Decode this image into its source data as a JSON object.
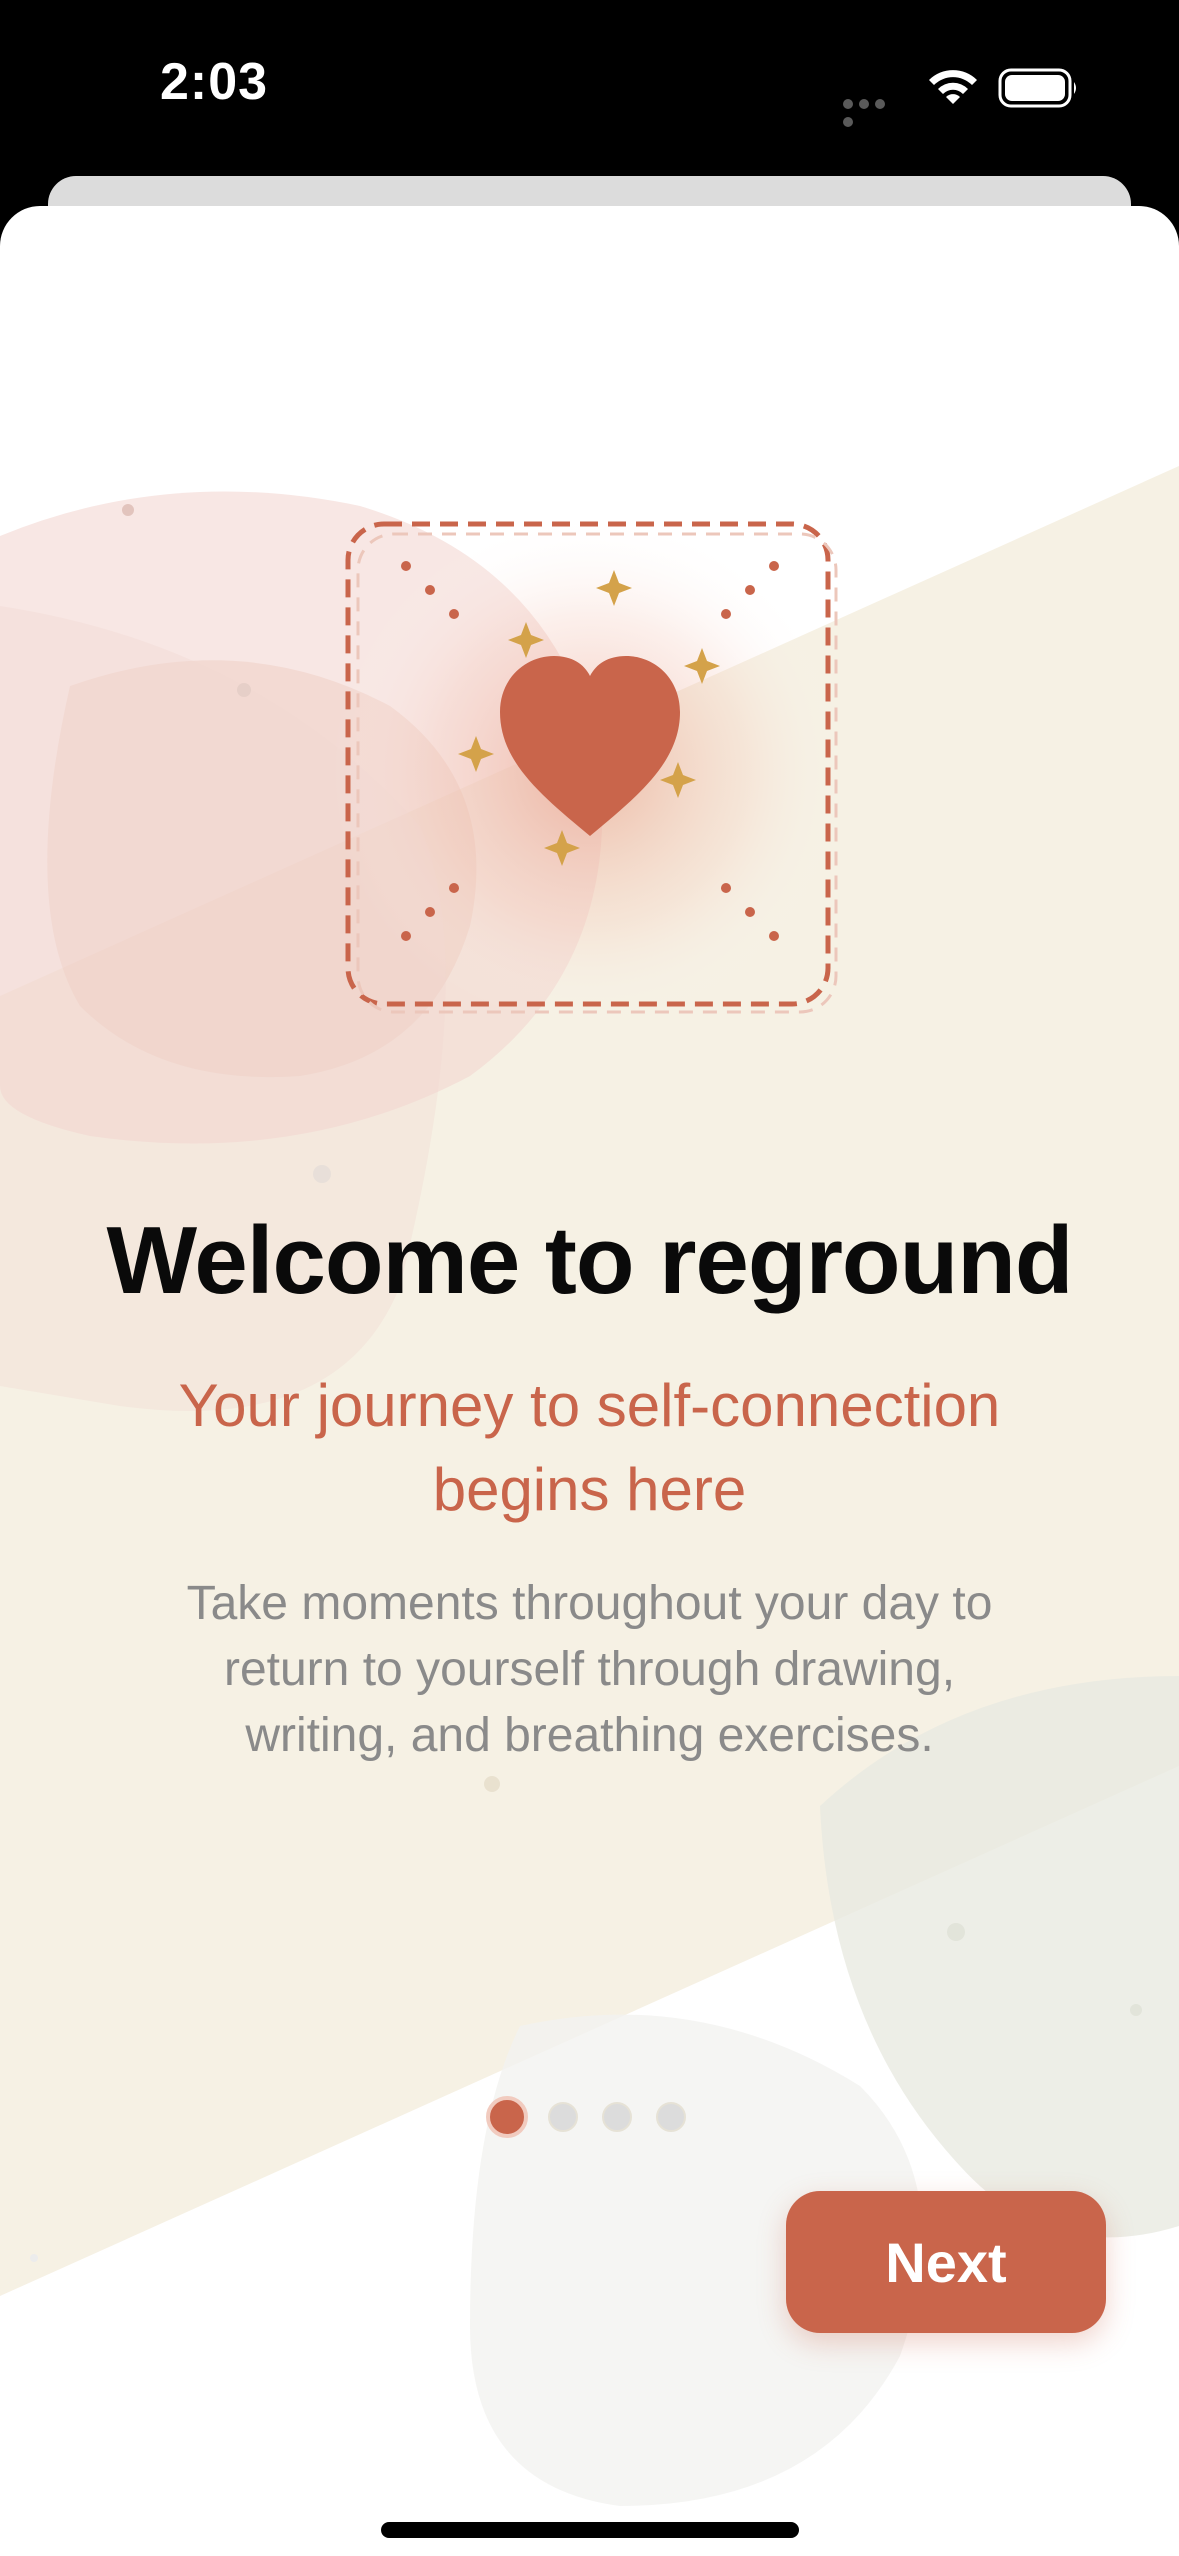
{
  "status_bar": {
    "time": "2:03"
  },
  "onboarding": {
    "title": "Welcome to reground",
    "subtitle": "Your journey to self-connection begins here",
    "body": "Take moments throughout your day to return to yourself through drawing, writing, and breathing exercises.",
    "pages_total": 4,
    "current_page": 1,
    "next_label": "Next"
  },
  "colors": {
    "accent": "#c9654b",
    "sparkle": "#d4a24a",
    "title": "#0a0a0a",
    "body": "#8a8a8a"
  },
  "icons": {
    "hero": "heart-icon",
    "sparkles": "sparkle-icon"
  }
}
